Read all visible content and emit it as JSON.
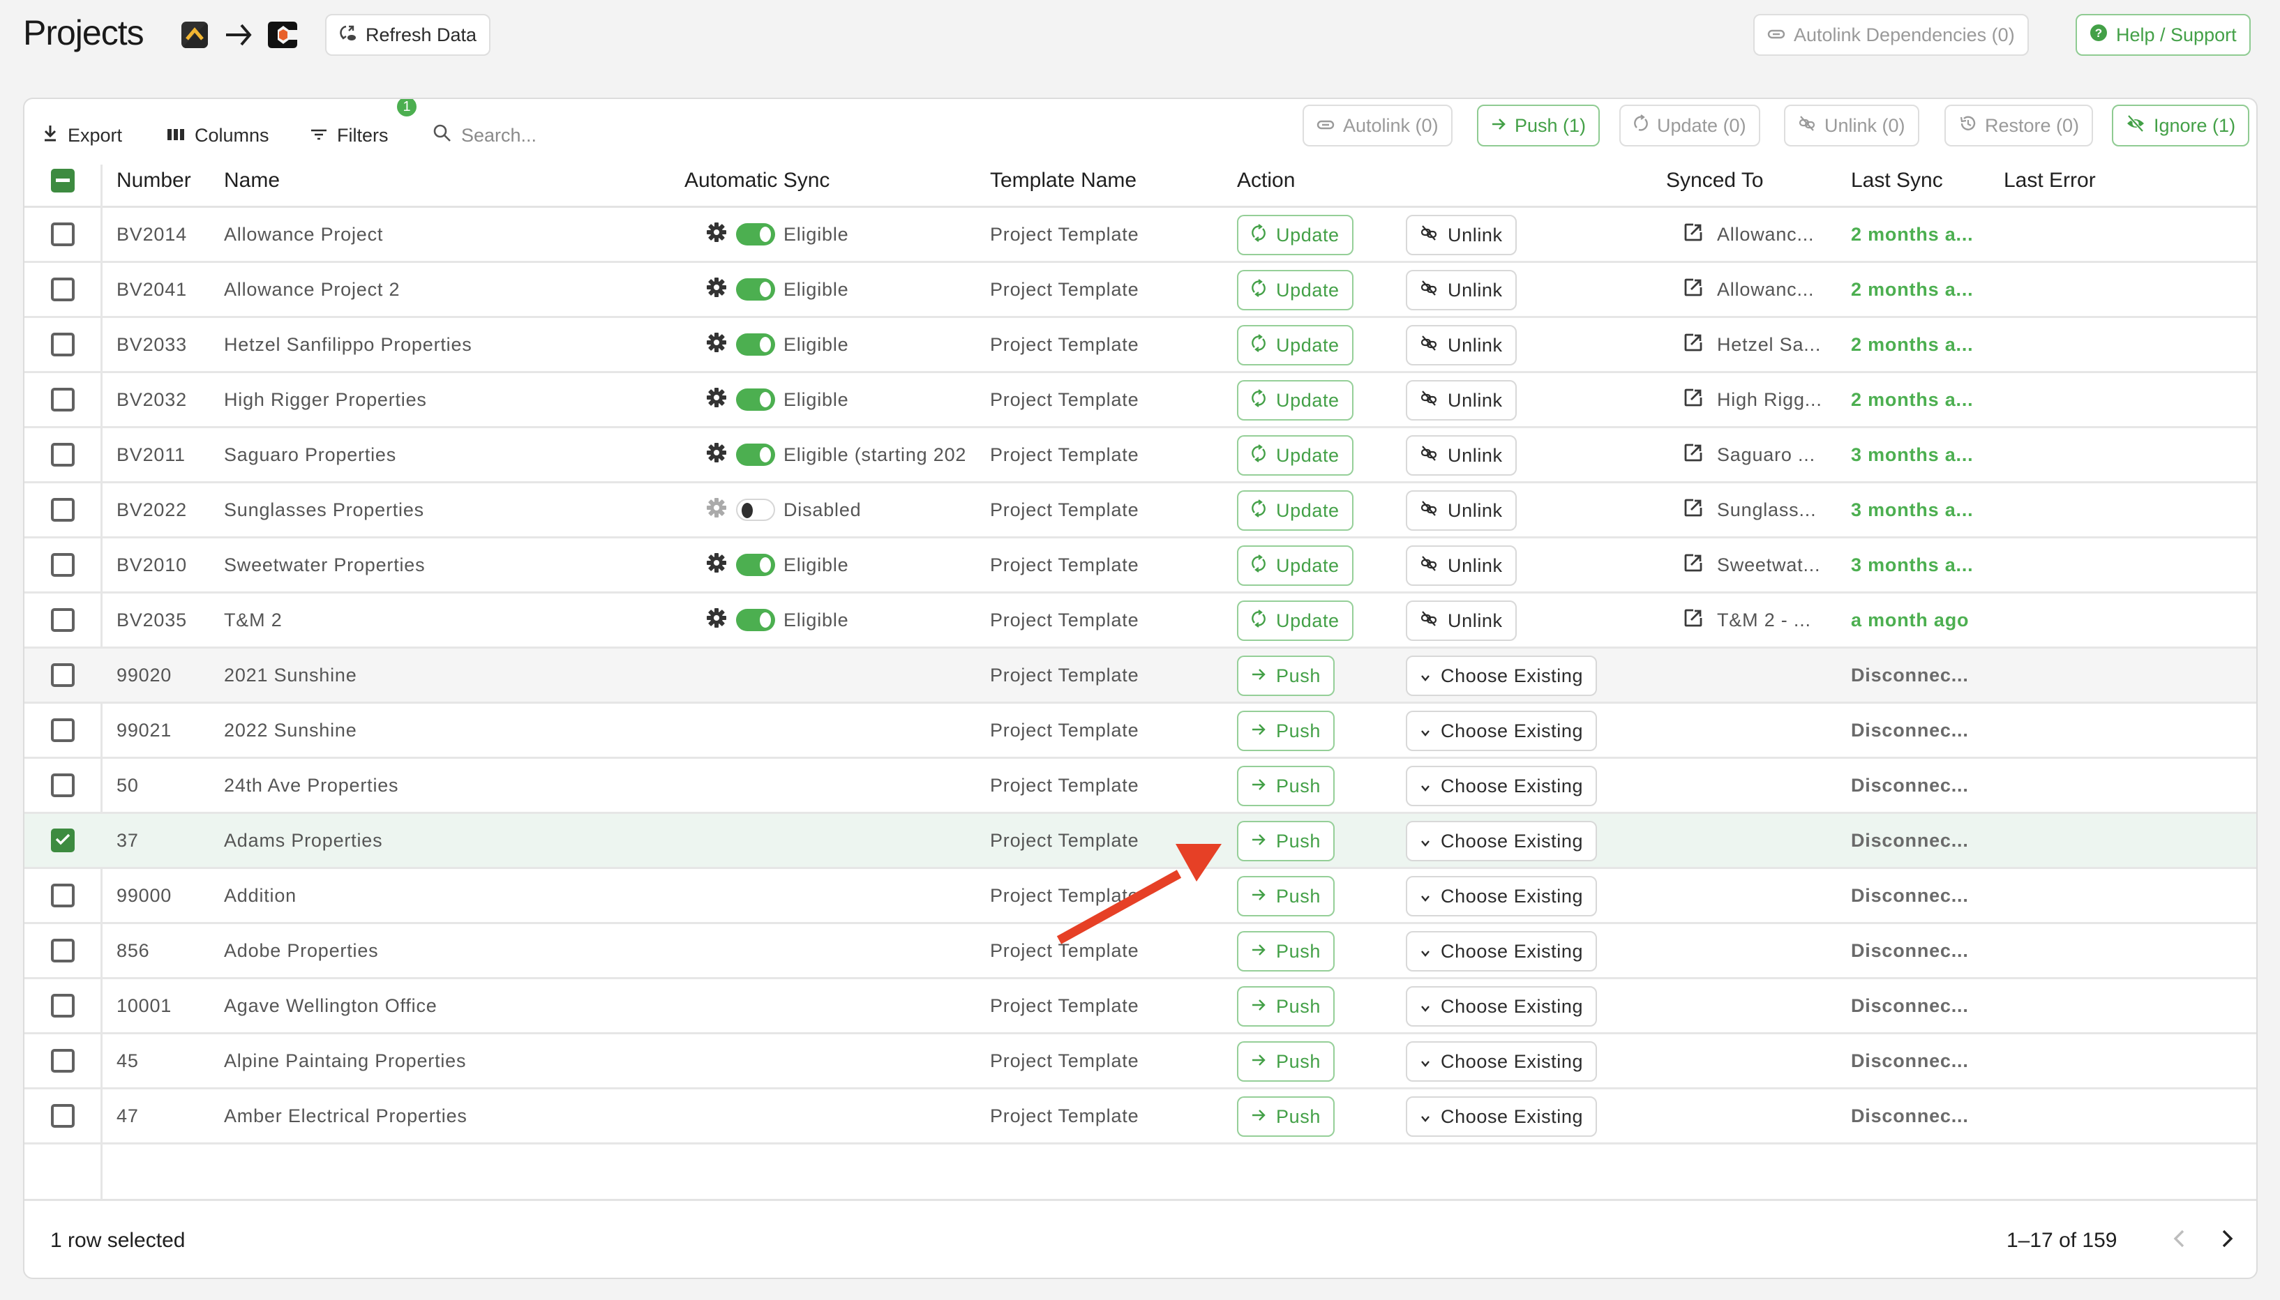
{
  "header": {
    "title": "Projects",
    "source_logo": "buildertrend-logo",
    "target_logo": "company-c-logo",
    "refresh_label": "Refresh Data",
    "autolink_deps_label": "Autolink Dependencies (0)",
    "help_label": "Help / Support"
  },
  "toolbar": {
    "export_label": "Export",
    "columns_label": "Columns",
    "filters_label": "Filters",
    "filters_count": "1",
    "search_placeholder": "Search...",
    "bulk_actions": {
      "autolink": "Autolink (0)",
      "push": "Push (1)",
      "update": "Update (0)",
      "unlink": "Unlink (0)",
      "restore": "Restore (0)",
      "ignore": "Ignore (1)"
    }
  },
  "columns": {
    "number": "Number",
    "name": "Name",
    "automatic_sync": "Automatic Sync",
    "template_name": "Template Name",
    "action": "Action",
    "synced_to": "Synced To",
    "last_sync": "Last Sync",
    "last_error": "Last Error"
  },
  "rows": [
    {
      "number": "BV2014",
      "name": "Allowance Project",
      "sync_enabled": true,
      "sync_status": "Eligible",
      "template": "Project Template",
      "primary_action": "Update",
      "secondary_action": "Unlink",
      "synced_to": "Allowanc...",
      "last_sync": "2 months a...",
      "last_error": "",
      "selected": false
    },
    {
      "number": "BV2041",
      "name": "Allowance Project 2",
      "sync_enabled": true,
      "sync_status": "Eligible",
      "template": "Project Template",
      "primary_action": "Update",
      "secondary_action": "Unlink",
      "synced_to": "Allowanc...",
      "last_sync": "2 months a...",
      "last_error": "",
      "selected": false
    },
    {
      "number": "BV2033",
      "name": "Hetzel Sanfilippo Properties",
      "sync_enabled": true,
      "sync_status": "Eligible",
      "template": "Project Template",
      "primary_action": "Update",
      "secondary_action": "Unlink",
      "synced_to": "Hetzel Sa...",
      "last_sync": "2 months a...",
      "last_error": "",
      "selected": false
    },
    {
      "number": "BV2032",
      "name": "High Rigger Properties",
      "sync_enabled": true,
      "sync_status": "Eligible",
      "template": "Project Template",
      "primary_action": "Update",
      "secondary_action": "Unlink",
      "synced_to": "High Rigg...",
      "last_sync": "2 months a...",
      "last_error": "",
      "selected": false
    },
    {
      "number": "BV2011",
      "name": "Saguaro Properties",
      "sync_enabled": true,
      "sync_status": "Eligible (starting 202",
      "template": "Project Template",
      "primary_action": "Update",
      "secondary_action": "Unlink",
      "synced_to": "Saguaro ...",
      "last_sync": "3 months a...",
      "last_error": "",
      "selected": false
    },
    {
      "number": "BV2022",
      "name": "Sunglasses Properties",
      "sync_enabled": false,
      "sync_status": "Disabled",
      "template": "Project Template",
      "primary_action": "Update",
      "secondary_action": "Unlink",
      "synced_to": "Sunglass...",
      "last_sync": "3 months a...",
      "last_error": "",
      "selected": false
    },
    {
      "number": "BV2010",
      "name": "Sweetwater Properties",
      "sync_enabled": true,
      "sync_status": "Eligible",
      "template": "Project Template",
      "primary_action": "Update",
      "secondary_action": "Unlink",
      "synced_to": "Sweetwat...",
      "last_sync": "3 months a...",
      "last_error": "",
      "selected": false
    },
    {
      "number": "BV2035",
      "name": "T&M 2",
      "sync_enabled": true,
      "sync_status": "Eligible",
      "template": "Project Template",
      "primary_action": "Update",
      "secondary_action": "Unlink",
      "synced_to": "T&M 2 - ...",
      "last_sync": "a month ago",
      "last_error": "",
      "selected": false
    },
    {
      "number": "99020",
      "name": "2021 Sunshine",
      "sync_enabled": null,
      "sync_status": "",
      "template": "Project Template",
      "primary_action": "Push",
      "secondary_action": "Choose Existing",
      "synced_to": "",
      "last_sync": "Disconnec...",
      "last_error": "",
      "selected": false,
      "hover": true
    },
    {
      "number": "99021",
      "name": "2022 Sunshine",
      "sync_enabled": null,
      "sync_status": "",
      "template": "Project Template",
      "primary_action": "Push",
      "secondary_action": "Choose Existing",
      "synced_to": "",
      "last_sync": "Disconnec...",
      "last_error": "",
      "selected": false
    },
    {
      "number": "50",
      "name": "24th Ave Properties",
      "sync_enabled": null,
      "sync_status": "",
      "template": "Project Template",
      "primary_action": "Push",
      "secondary_action": "Choose Existing",
      "synced_to": "",
      "last_sync": "Disconnec...",
      "last_error": "",
      "selected": false
    },
    {
      "number": "37",
      "name": "Adams Properties",
      "sync_enabled": null,
      "sync_status": "",
      "template": "Project Template",
      "primary_action": "Push",
      "secondary_action": "Choose Existing",
      "synced_to": "",
      "last_sync": "Disconnec...",
      "last_error": "",
      "selected": true
    },
    {
      "number": "99000",
      "name": "Addition",
      "sync_enabled": null,
      "sync_status": "",
      "template": "Project Template",
      "primary_action": "Push",
      "secondary_action": "Choose Existing",
      "synced_to": "",
      "last_sync": "Disconnec...",
      "last_error": "",
      "selected": false
    },
    {
      "number": "856",
      "name": "Adobe Properties",
      "sync_enabled": null,
      "sync_status": "",
      "template": "Project Template",
      "primary_action": "Push",
      "secondary_action": "Choose Existing",
      "synced_to": "",
      "last_sync": "Disconnec...",
      "last_error": "",
      "selected": false
    },
    {
      "number": "10001",
      "name": "Agave Wellington Office",
      "sync_enabled": null,
      "sync_status": "",
      "template": "Project Template",
      "primary_action": "Push",
      "secondary_action": "Choose Existing",
      "synced_to": "",
      "last_sync": "Disconnec...",
      "last_error": "",
      "selected": false
    },
    {
      "number": "45",
      "name": "Alpine Paintaing Properties",
      "sync_enabled": null,
      "sync_status": "",
      "template": "Project Template",
      "primary_action": "Push",
      "secondary_action": "Choose Existing",
      "synced_to": "",
      "last_sync": "Disconnec...",
      "last_error": "",
      "selected": false
    },
    {
      "number": "47",
      "name": "Amber Electrical Properties",
      "sync_enabled": null,
      "sync_status": "",
      "template": "Project Template",
      "primary_action": "Push",
      "secondary_action": "Choose Existing",
      "synced_to": "",
      "last_sync": "Disconnec...",
      "last_error": "",
      "selected": false
    }
  ],
  "footer": {
    "selection_text": "1 row selected",
    "pagination_text": "1–17 of 159"
  },
  "colors": {
    "accent_green": "#4caf50",
    "checkbox_green": "#3d8b40",
    "annotation_red": "#e64026"
  }
}
